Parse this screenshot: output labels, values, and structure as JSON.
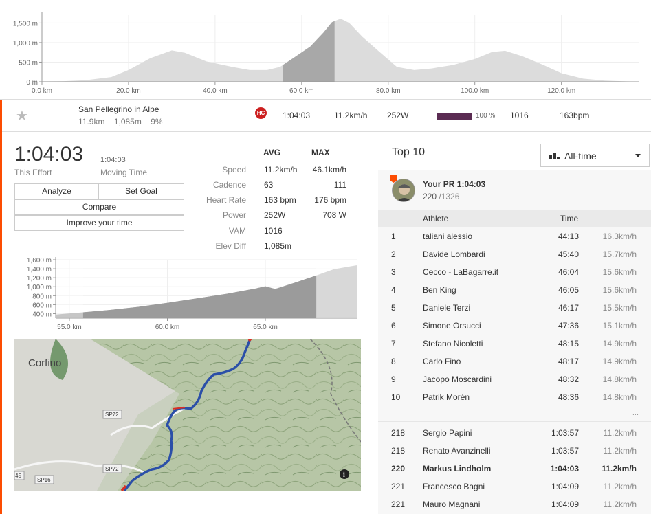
{
  "elevation_profile": {
    "y_ticks": [
      "0 m",
      "500 m",
      "1,000 m",
      "1,500 m"
    ],
    "x_ticks": [
      "0.0 km",
      "20.0 km",
      "40.0 km",
      "60.0 km",
      "80.0 km",
      "100.0 km",
      "120.0 km"
    ],
    "x_range_km": [
      0,
      138
    ],
    "y_range_m": [
      0,
      1700
    ],
    "highlight_km": [
      55.7,
      67.6
    ],
    "profile": [
      [
        0,
        10
      ],
      [
        5,
        15
      ],
      [
        10,
        40
      ],
      [
        16,
        120
      ],
      [
        20,
        300
      ],
      [
        25,
        600
      ],
      [
        30,
        800
      ],
      [
        33,
        740
      ],
      [
        38,
        520
      ],
      [
        44,
        380
      ],
      [
        48,
        300
      ],
      [
        52,
        300
      ],
      [
        55,
        380
      ],
      [
        58,
        600
      ],
      [
        62,
        900
      ],
      [
        65,
        1250
      ],
      [
        67,
        1520
      ],
      [
        69,
        1610
      ],
      [
        71,
        1500
      ],
      [
        74,
        1150
      ],
      [
        78,
        760
      ],
      [
        82,
        380
      ],
      [
        86,
        300
      ],
      [
        90,
        340
      ],
      [
        95,
        430
      ],
      [
        100,
        580
      ],
      [
        104,
        760
      ],
      [
        107,
        790
      ],
      [
        111,
        650
      ],
      [
        116,
        420
      ],
      [
        120,
        220
      ],
      [
        125,
        80
      ],
      [
        130,
        30
      ],
      [
        135,
        10
      ],
      [
        138,
        5
      ]
    ]
  },
  "segment": {
    "name": "San Pellegrino in Alpe",
    "distance": "11.9km",
    "elevation": "1,085m",
    "grade": "9%",
    "category": "HC",
    "time": "1:04:03",
    "speed": "11.2km/h",
    "power": "252W",
    "percent": "100 %",
    "vam": "1016",
    "hr": "163bpm",
    "color_category": "#cc1f1f",
    "color_bar": "#5b2c53"
  },
  "effort": {
    "time": "1:04:03",
    "time_label": "This Effort",
    "moving_time": "1:04:03",
    "moving_label": "Moving Time"
  },
  "actions": {
    "analyze": "Analyze",
    "set_goal": "Set Goal",
    "compare": "Compare",
    "improve": "Improve your time"
  },
  "stats": {
    "avg_header": "AVG",
    "max_header": "MAX",
    "rows": [
      {
        "label": "Speed",
        "avg": "11.2km/h",
        "max": "46.1km/h"
      },
      {
        "label": "Cadence",
        "avg": "63",
        "max": "111"
      },
      {
        "label": "Heart Rate",
        "avg": "163 bpm",
        "max": "176 bpm"
      },
      {
        "label": "Power",
        "avg": "252W",
        "max": "708 W"
      },
      {
        "label": "VAM",
        "avg": "1016",
        "max": ""
      },
      {
        "label": "Elev Diff",
        "avg": "1,085m",
        "max": ""
      }
    ]
  },
  "segment_profile": {
    "y_ticks": [
      "400 m",
      "600 m",
      "800 m",
      "1,000 m",
      "1,200 m",
      "1,400 m",
      "1,600 m"
    ],
    "x_ticks": [
      "55.0 km",
      "60.0 km",
      "65.0 km"
    ],
    "x_range_km": [
      54.3,
      69.7
    ],
    "y_range_m": [
      300,
      1600
    ],
    "highlight_km": [
      55.7,
      67.6
    ],
    "profile": [
      [
        54.3,
        380
      ],
      [
        55.7,
        430
      ],
      [
        57,
        480
      ],
      [
        58.5,
        550
      ],
      [
        60,
        640
      ],
      [
        61.5,
        740
      ],
      [
        63,
        840
      ],
      [
        64.5,
        960
      ],
      [
        65,
        1010
      ],
      [
        65.5,
        950
      ],
      [
        66.5,
        1090
      ],
      [
        67.6,
        1250
      ],
      [
        68.5,
        1390
      ],
      [
        69.7,
        1480
      ]
    ]
  },
  "map": {
    "place": "Corfino",
    "road_labels": [
      "SP72",
      "SP72",
      "SP16",
      "45"
    ],
    "info_icon": "info-icon"
  },
  "leaderboard": {
    "title": "Top 10",
    "filter": "All-time",
    "pr_title": "Your PR 1:04:03",
    "pr_rank": "220",
    "pr_total": " /1326",
    "col_athlete": "Athlete",
    "col_time": "Time",
    "ellipsis": "...",
    "rows": [
      {
        "rank": "1",
        "name": "taliani alessio",
        "time": "44:13",
        "speed": "16.3km/h"
      },
      {
        "rank": "2",
        "name": "Davide Lombardi",
        "time": "45:40",
        "speed": "15.7km/h"
      },
      {
        "rank": "3",
        "name": "Cecco - LaBagarre.it",
        "time": "46:04",
        "speed": "15.6km/h"
      },
      {
        "rank": "4",
        "name": "Ben King",
        "time": "46:05",
        "speed": "15.6km/h"
      },
      {
        "rank": "5",
        "name": "Daniele Terzi",
        "time": "46:17",
        "speed": "15.5km/h"
      },
      {
        "rank": "6",
        "name": "Simone Orsucci",
        "time": "47:36",
        "speed": "15.1km/h"
      },
      {
        "rank": "7",
        "name": "Stefano Nicoletti",
        "time": "48:15",
        "speed": "14.9km/h"
      },
      {
        "rank": "8",
        "name": "Carlo Fino",
        "time": "48:17",
        "speed": "14.9km/h"
      },
      {
        "rank": "9",
        "name": "Jacopo Moscardini",
        "time": "48:32",
        "speed": "14.8km/h"
      },
      {
        "rank": "10",
        "name": "Patrik Morén",
        "time": "48:36",
        "speed": "14.8km/h"
      }
    ],
    "nearby": [
      {
        "rank": "218",
        "name": "Sergio Papini",
        "time": "1:03:57",
        "speed": "11.2km/h",
        "me": false
      },
      {
        "rank": "218",
        "name": "Renato Avanzinelli",
        "time": "1:03:57",
        "speed": "11.2km/h",
        "me": false
      },
      {
        "rank": "220",
        "name": "Markus Lindholm",
        "time": "1:04:03",
        "speed": "11.2km/h",
        "me": true
      },
      {
        "rank": "221",
        "name": "Francesco Bagni",
        "time": "1:04:09",
        "speed": "11.2km/h",
        "me": false
      },
      {
        "rank": "221",
        "name": "Mauro Magnani",
        "time": "1:04:09",
        "speed": "11.2km/h",
        "me": false
      }
    ]
  },
  "colors": {
    "accent": "#fc4c02",
    "route": "#2b4fa8"
  }
}
